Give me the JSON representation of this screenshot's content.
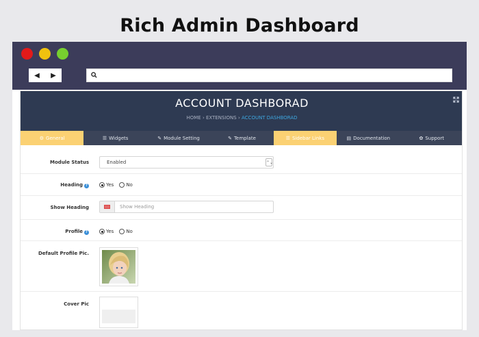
{
  "headline": "Rich Admin Dashboard",
  "browser": {
    "nav": {
      "back_icon": "◀",
      "forward_icon": "▶"
    },
    "search_icon": "search-icon",
    "url_value": ""
  },
  "panel": {
    "title": "ACCOUNT DASHBORAD",
    "breadcrumb": {
      "home": "HOME",
      "extensions": "EXTENSIONS",
      "current": "ACCOUNT DASHBORAD",
      "separator": "›"
    },
    "expand_icon": "expand-icon"
  },
  "tabs": [
    {
      "label": "General",
      "icon": "⚙",
      "state": "active"
    },
    {
      "label": "Widgets",
      "icon": "☰",
      "state": ""
    },
    {
      "label": "Module Setting",
      "icon": "✎",
      "state": ""
    },
    {
      "label": "Template",
      "icon": "✎",
      "state": ""
    },
    {
      "label": "Sidebar Links",
      "icon": "☰",
      "state": "highlight"
    },
    {
      "label": "Documentation",
      "icon": "▤",
      "state": ""
    },
    {
      "label": "Support",
      "icon": "✿",
      "state": ""
    }
  ],
  "form": {
    "module_status": {
      "label": "Module Status",
      "value": "Enabled"
    },
    "heading": {
      "label": "Heading",
      "help": "?",
      "yes": "Yes",
      "no": "No",
      "selected": "yes"
    },
    "show_heading": {
      "label": "Show Heading",
      "placeholder": "Show Heading",
      "value": ""
    },
    "profile": {
      "label": "Profile",
      "help": "?",
      "yes": "Yes",
      "no": "No",
      "selected": "yes"
    },
    "default_profile_pic": {
      "label": "Default Profile Pic."
    },
    "cover_pic": {
      "label": "Cover Pic"
    }
  },
  "colors": {
    "chrome_bg": "#3c3c5a",
    "panel_header_bg": "#2e3a52",
    "tab_bar_bg": "#3b4459",
    "tab_active_bg": "#fbd173",
    "breadcrumb_active": "#3ea7e0",
    "help_badge": "#3a8fd8"
  }
}
